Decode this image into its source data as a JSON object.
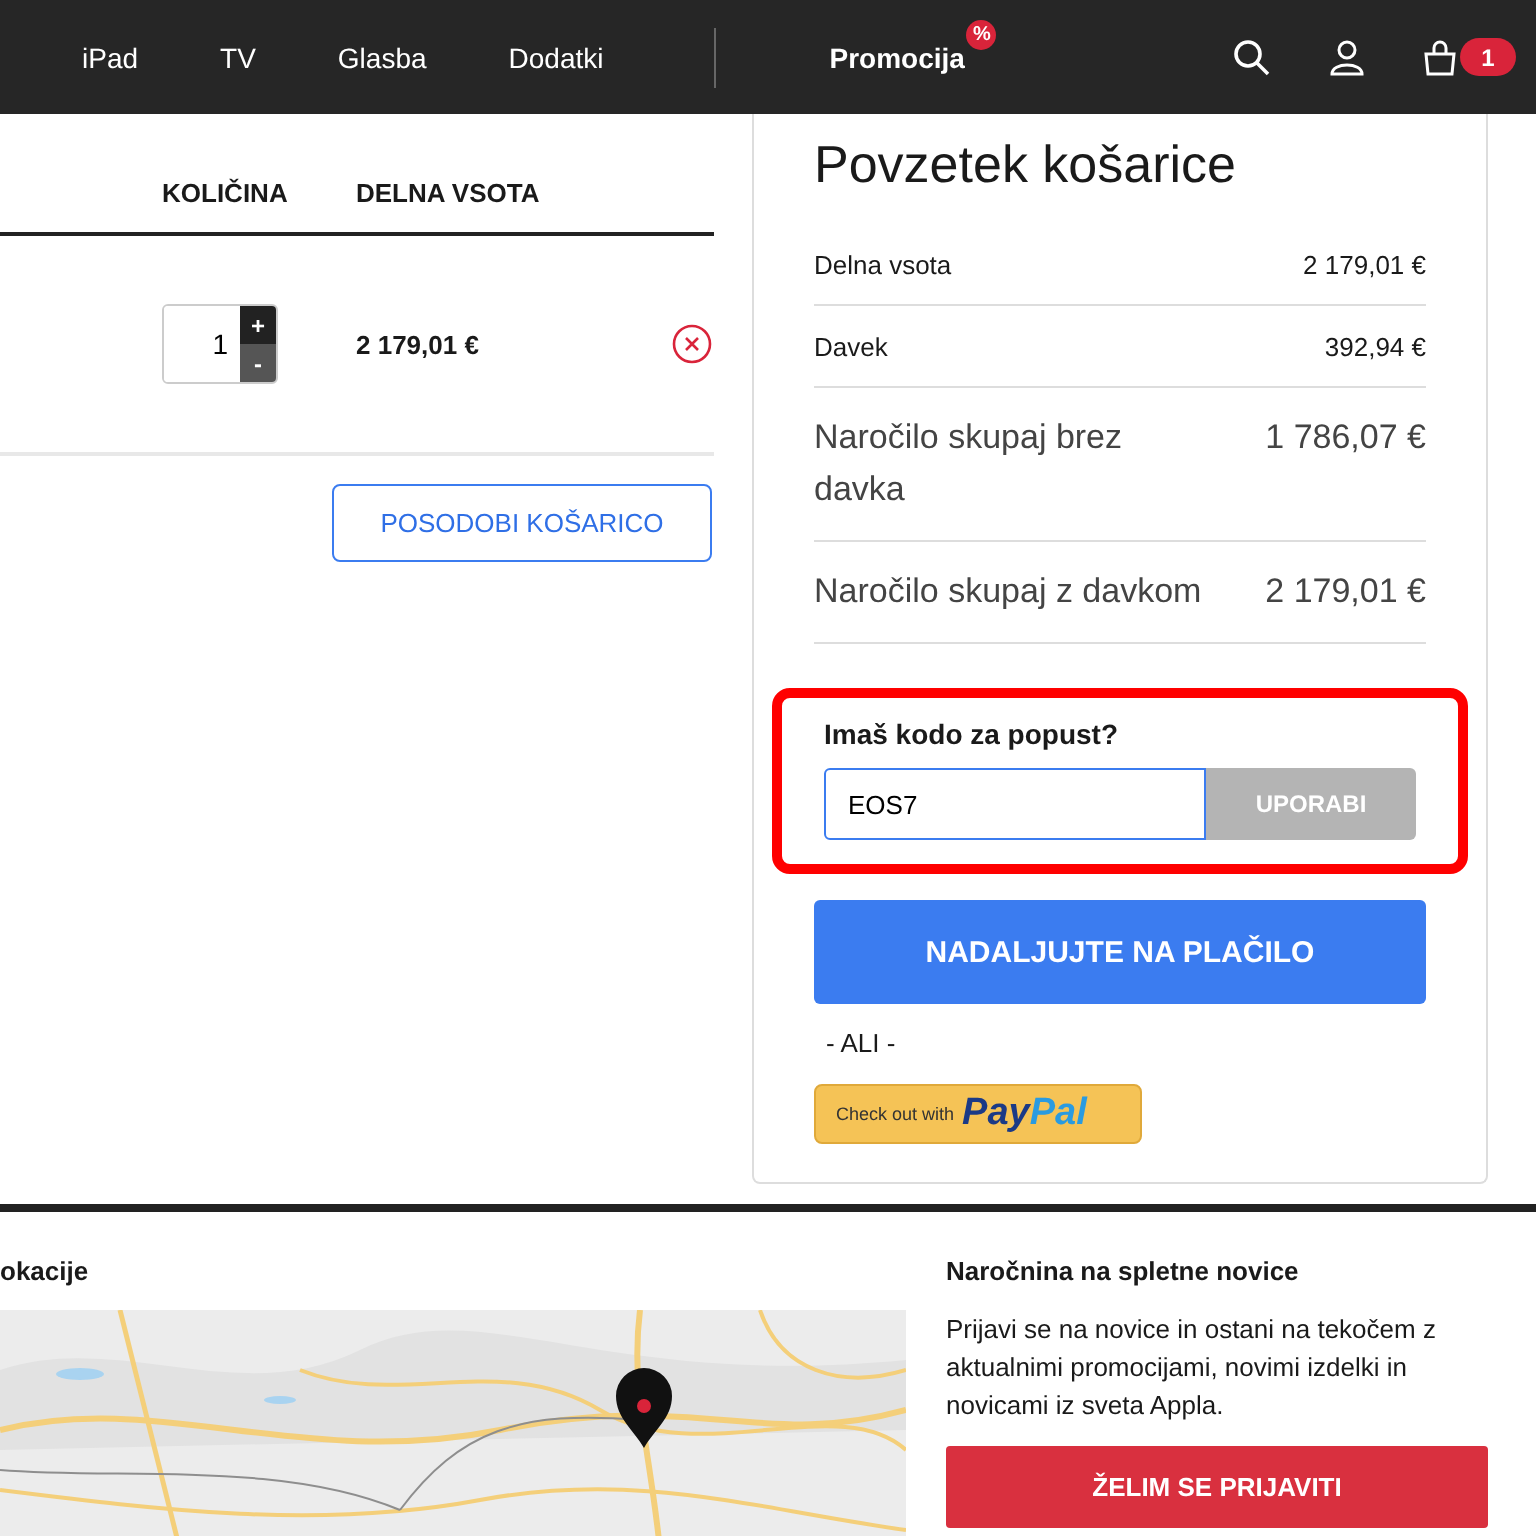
{
  "nav": {
    "items": [
      {
        "label": "iPad"
      },
      {
        "label": "TV"
      },
      {
        "label": "Glasba"
      },
      {
        "label": "Dodatki"
      }
    ],
    "promo": {
      "label": "Promocija",
      "badge": "%"
    },
    "cart_count": "1"
  },
  "cart": {
    "columns": [
      "KOLIČINA",
      "DELNA VSOTA"
    ],
    "rows": [
      {
        "quantity": "1",
        "increment": "+",
        "decrement": "-",
        "subtotal": "2 179,01 €"
      }
    ],
    "update_button": "POSODOBI KOŠARICO"
  },
  "summary": {
    "title": "Povzetek košarice",
    "rows": [
      {
        "label": "Delna vsota",
        "value": "2 179,01 €",
        "kind": "small"
      },
      {
        "label": "Davek",
        "value": "392,94 €",
        "kind": "small"
      },
      {
        "label": "Naročilo skupaj brez davka",
        "value": "1 786,07 €",
        "kind": "large"
      },
      {
        "label": "Naročilo skupaj z davkom",
        "value": "2 179,01 €",
        "kind": "large"
      }
    ],
    "coupon": {
      "label": "Imaš kodo za popust?",
      "value": "EOS7",
      "button": "UPORABI",
      "highlighted": true
    },
    "checkout_button": "NADALJUJTE NA PLAČILO",
    "or": "- ALI -",
    "paypal": {
      "prefix": "Check out with",
      "brand": [
        "Pay",
        "Pal"
      ]
    }
  },
  "footer": {
    "locations_title": "okacije",
    "newsletter": {
      "title": "Naročnina na spletne novice",
      "text": "Prijavi se na novice in ostani na tekočem z aktualnimi promocijami, novimi izdelki in novicami iz sveta Appla.",
      "button": "ŽELIM SE PRIJAVITI"
    }
  }
}
